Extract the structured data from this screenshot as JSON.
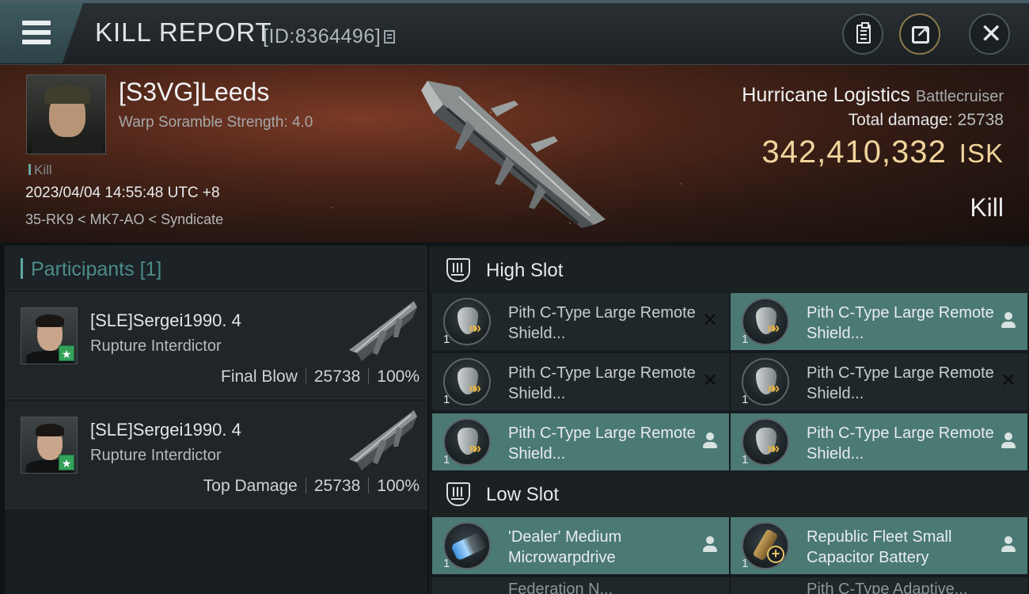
{
  "header": {
    "title": "KILL REPORT",
    "report_id": "[ID:8364496]",
    "icons": [
      "menu-icon",
      "copy-icon",
      "clipboard-icon",
      "share-icon",
      "close-icon"
    ]
  },
  "victim": {
    "name": "[S3VG]Leeds",
    "subtitle": "Warp Soramble Strength: 4.0",
    "tag": "Kill",
    "time": "2023/04/04 14:55:48 UTC +8",
    "location": "35-RK9 < MK7-AO < Syndicate",
    "ship_name": "Hurricane Logistics",
    "ship_class": "Battlecruiser",
    "total_damage_label": "Total damage:",
    "total_damage": "25738",
    "isk_value": "342,410,332",
    "isk_unit": "ISK",
    "result": "Kill"
  },
  "participants": {
    "title": "Participants",
    "count": "[1]",
    "items": [
      {
        "name": "[SLE]Sergei1990. 4",
        "ship": "Rupture Interdictor",
        "role": "Final Blow",
        "damage": "25738",
        "percent": "100%"
      },
      {
        "name": "[SLE]Sergei1990. 4",
        "ship": "Rupture Interdictor",
        "role": "Top Damage",
        "damage": "25738",
        "percent": "100%"
      }
    ]
  },
  "slots": {
    "high": {
      "label": "High Slot",
      "modules": [
        {
          "name": "Pith C-Type Large Remote Shield...",
          "qty": "1",
          "status": "destroyed",
          "icon": "shield-booster-icon"
        },
        {
          "name": "Pith C-Type Large Remote Shield...",
          "qty": "1",
          "status": "dropped",
          "icon": "shield-booster-icon"
        },
        {
          "name": "Pith C-Type Large Remote Shield...",
          "qty": "1",
          "status": "destroyed",
          "icon": "shield-booster-icon"
        },
        {
          "name": "Pith C-Type Large Remote Shield...",
          "qty": "1",
          "status": "destroyed",
          "icon": "shield-booster-icon"
        },
        {
          "name": "Pith C-Type Large Remote Shield...",
          "qty": "1",
          "status": "dropped",
          "icon": "shield-booster-icon"
        },
        {
          "name": "Pith C-Type Large Remote Shield...",
          "qty": "1",
          "status": "dropped",
          "icon": "shield-booster-icon"
        }
      ]
    },
    "low": {
      "label": "Low Slot",
      "modules": [
        {
          "name": "'Dealer' Medium Microwarpdrive",
          "qty": "1",
          "status": "dropped",
          "icon": "microwarpdrive-icon"
        },
        {
          "name": "Republic Fleet Small Capacitor Battery",
          "qty": "1",
          "status": "dropped",
          "icon": "capacitor-battery-icon"
        }
      ],
      "partial": [
        "Federation N...",
        "Pith C-Type Adaptive..."
      ]
    }
  },
  "colors": {
    "accent_teal": "#4b7974",
    "isk_gold": "#f1d49b",
    "participants_title": "#4d8c8b"
  }
}
